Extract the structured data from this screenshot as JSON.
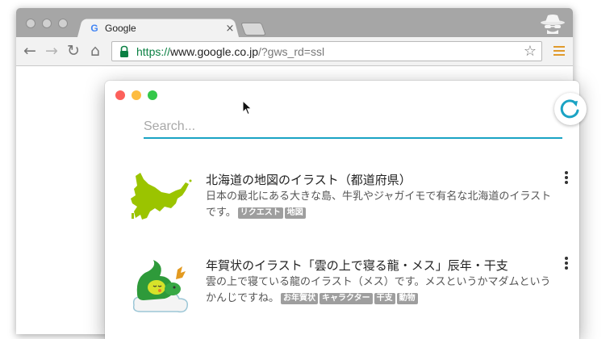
{
  "browser": {
    "tab": {
      "favicon": "G",
      "title": "Google",
      "close": "×"
    },
    "nav": {
      "back": "←",
      "forward": "→",
      "reload": "↻",
      "home": "⌂"
    },
    "address": {
      "scheme": "https://",
      "host": "www.google.co.jp",
      "path": "/?gws_rd=ssl"
    },
    "star": "☆",
    "icons": [
      "incognito-icon",
      "lock-icon",
      "star-icon",
      "menu-icon"
    ]
  },
  "app": {
    "colors": {
      "close": "#fc605b",
      "minimize": "#fdbc40",
      "zoom": "#34c84a",
      "accent": "#1aa3c4",
      "tag": "#9e9e9e"
    },
    "search": {
      "placeholder": "Search...",
      "value": ""
    },
    "results": [
      {
        "title": "北海道の地図のイラスト（都道府県）",
        "desc": "日本の最北にある大きな島、牛乳やジャガイモで有名な北海道のイラストです。",
        "tags": [
          "リクエスト",
          "地図"
        ],
        "thumb": "hokkaido-map"
      },
      {
        "title": "年賀状のイラスト「雲の上で寝る龍・メス」辰年・干支",
        "desc": "雲の上で寝ている龍のイラスト（メス）です。メスというかマダムというかんじですね。",
        "tags": [
          "お年賀状",
          "キャラクター",
          "干支",
          "動物"
        ],
        "thumb": "sleeping-dragon"
      }
    ]
  }
}
